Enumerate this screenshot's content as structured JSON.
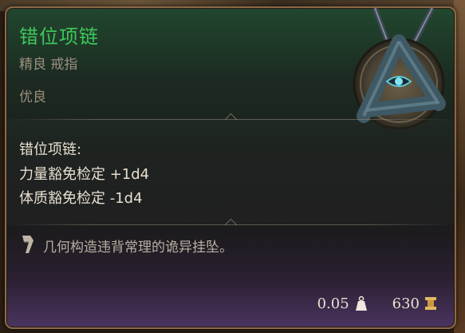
{
  "item": {
    "name": "错位项链",
    "subtitle": "精良 戒指",
    "rarity": "优良"
  },
  "effects": {
    "header": "错位项链:",
    "lines": [
      "力量豁免检定 +1d4",
      "体质豁免检定 -1d4"
    ]
  },
  "description": "几何构造违背常理的诡异挂坠。",
  "footer": {
    "weight": "0.05",
    "price": "630"
  },
  "colors": {
    "title": "#3fc65a",
    "text": "#e8dfd0",
    "muted": "#9c8f7f",
    "border": "#8a6a48"
  }
}
